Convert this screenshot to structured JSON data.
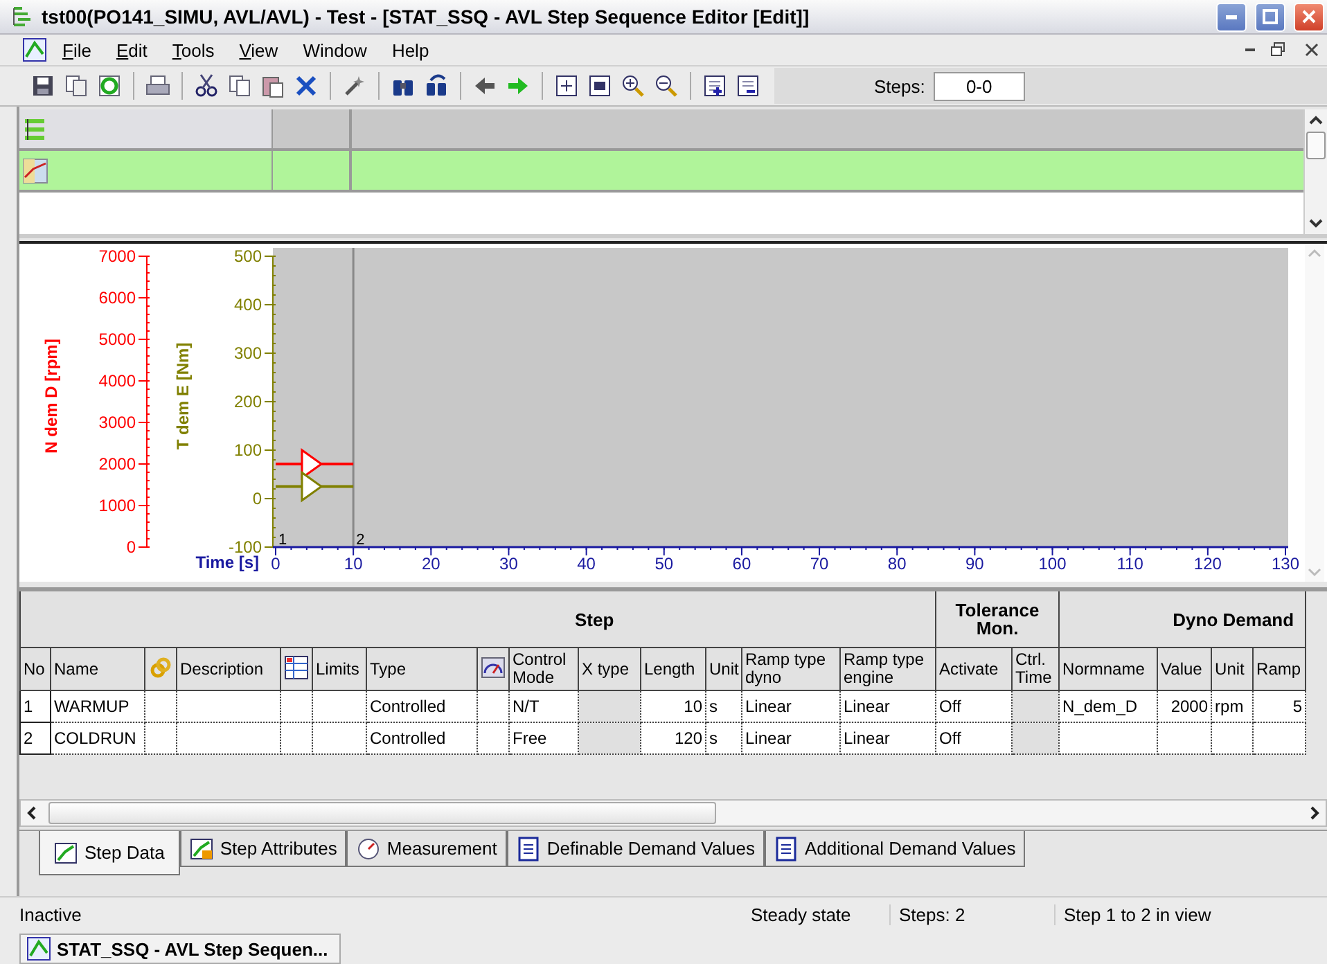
{
  "window": {
    "title": "tst00(PO141_SIMU, AVL/AVL) - Test - [STAT_SSQ - AVL Step Sequence Editor [Edit]]"
  },
  "menu": [
    {
      "label": "File",
      "underlined_first": true
    },
    {
      "label": "Edit",
      "underlined_first": true
    },
    {
      "label": "Tools",
      "underlined_first": true
    },
    {
      "label": "View",
      "underlined_first": true
    },
    {
      "label": "Window",
      "underlined_first": false
    },
    {
      "label": "Help",
      "underlined_first": false
    }
  ],
  "toolbar": {
    "steps_label": "Steps:",
    "steps_value": "0-0"
  },
  "sequence_panel": {
    "rows": [
      {
        "kind": "header",
        "highlighted": false
      },
      {
        "kind": "curve",
        "highlighted": true
      }
    ]
  },
  "chart": {
    "chart_data": {
      "type": "line",
      "xlabel": "Time [s]",
      "ylabel": "N dem D [rpm]",
      "y2label": "T dem E [Nm]",
      "xlim": [
        0,
        130
      ],
      "ylim": [
        0,
        7000
      ],
      "y2lim": [
        -100,
        500
      ],
      "xticks": [
        0,
        10,
        20,
        30,
        40,
        50,
        60,
        70,
        80,
        90,
        100,
        110,
        120,
        130
      ],
      "yticks": [
        0,
        1000,
        2000,
        3000,
        4000,
        5000,
        6000,
        7000
      ],
      "y2ticks": [
        -100,
        0,
        100,
        200,
        300,
        400,
        500
      ],
      "x": [
        0,
        10
      ],
      "series": [
        {
          "color": "#ff0000",
          "axis": "y",
          "values": [
            2000,
            2000
          ]
        },
        {
          "color": "#808000",
          "axis": "y2",
          "values": [
            25,
            25
          ]
        }
      ],
      "annotations": [
        {
          "text": "1"
        },
        {
          "text": "2"
        }
      ]
    }
  },
  "table": {
    "groups": [
      {
        "label": "Step",
        "columns": [
          {
            "kind": "text",
            "label": "No"
          },
          {
            "kind": "text",
            "label": "Name"
          },
          {
            "kind": "link"
          },
          {
            "kind": "text",
            "label": "Description"
          },
          {
            "kind": "grid"
          },
          {
            "kind": "text",
            "label": "Limits"
          },
          {
            "kind": "text",
            "label": "Type"
          },
          {
            "kind": "gauge"
          },
          {
            "kind": "text",
            "label": "Control Mode"
          },
          {
            "kind": "text",
            "label": "X type",
            "shaded": true
          },
          {
            "kind": "text",
            "label": "Length",
            "numeric": true
          },
          {
            "kind": "text",
            "label": "Unit"
          },
          {
            "kind": "text",
            "label": "Ramp type dyno"
          },
          {
            "kind": "text",
            "label": "Ramp type engine"
          }
        ]
      },
      {
        "label": "Tolerance Mon.",
        "columns": [
          {
            "kind": "text",
            "label": "Activate"
          },
          {
            "kind": "text",
            "label": "Ctrl. Time",
            "shaded": true
          }
        ]
      },
      {
        "label": "Dyno Demand",
        "columns": [
          {
            "kind": "text",
            "label": "Normname"
          },
          {
            "kind": "text",
            "label": "Value",
            "numeric": true
          },
          {
            "kind": "text",
            "label": "Unit"
          },
          {
            "kind": "text",
            "label": "Ramp",
            "numeric": true
          }
        ]
      }
    ],
    "rows": [
      {
        "cells": [
          "1",
          "WARMUP",
          null,
          null,
          null,
          null,
          "Controlled",
          null,
          "N/T",
          null,
          "10",
          "s",
          "Linear",
          "Linear",
          "Off",
          null,
          "N_dem_D",
          "2000",
          "rpm",
          "5"
        ]
      },
      {
        "cells": [
          "2",
          "COLDRUN",
          null,
          null,
          null,
          null,
          "Controlled",
          null,
          "Free",
          null,
          "120",
          "s",
          "Linear",
          "Linear",
          "Off",
          null,
          null,
          null,
          null,
          null
        ]
      }
    ]
  },
  "tabs": [
    {
      "label": "Step Data",
      "selected": true
    },
    {
      "label": "Step Attributes",
      "selected": false
    },
    {
      "label": "Measurement",
      "selected": false
    },
    {
      "label": "Definable Demand Values",
      "selected": false
    },
    {
      "label": "Additional Demand Values",
      "selected": false
    }
  ],
  "status_bar": {
    "state": "Inactive",
    "mode": "Steady state",
    "steps": "Steps: 2",
    "view": "Step 1 to 2 in view"
  },
  "taskbar": {
    "item": "STAT_SSQ - AVL Step Sequen..."
  }
}
